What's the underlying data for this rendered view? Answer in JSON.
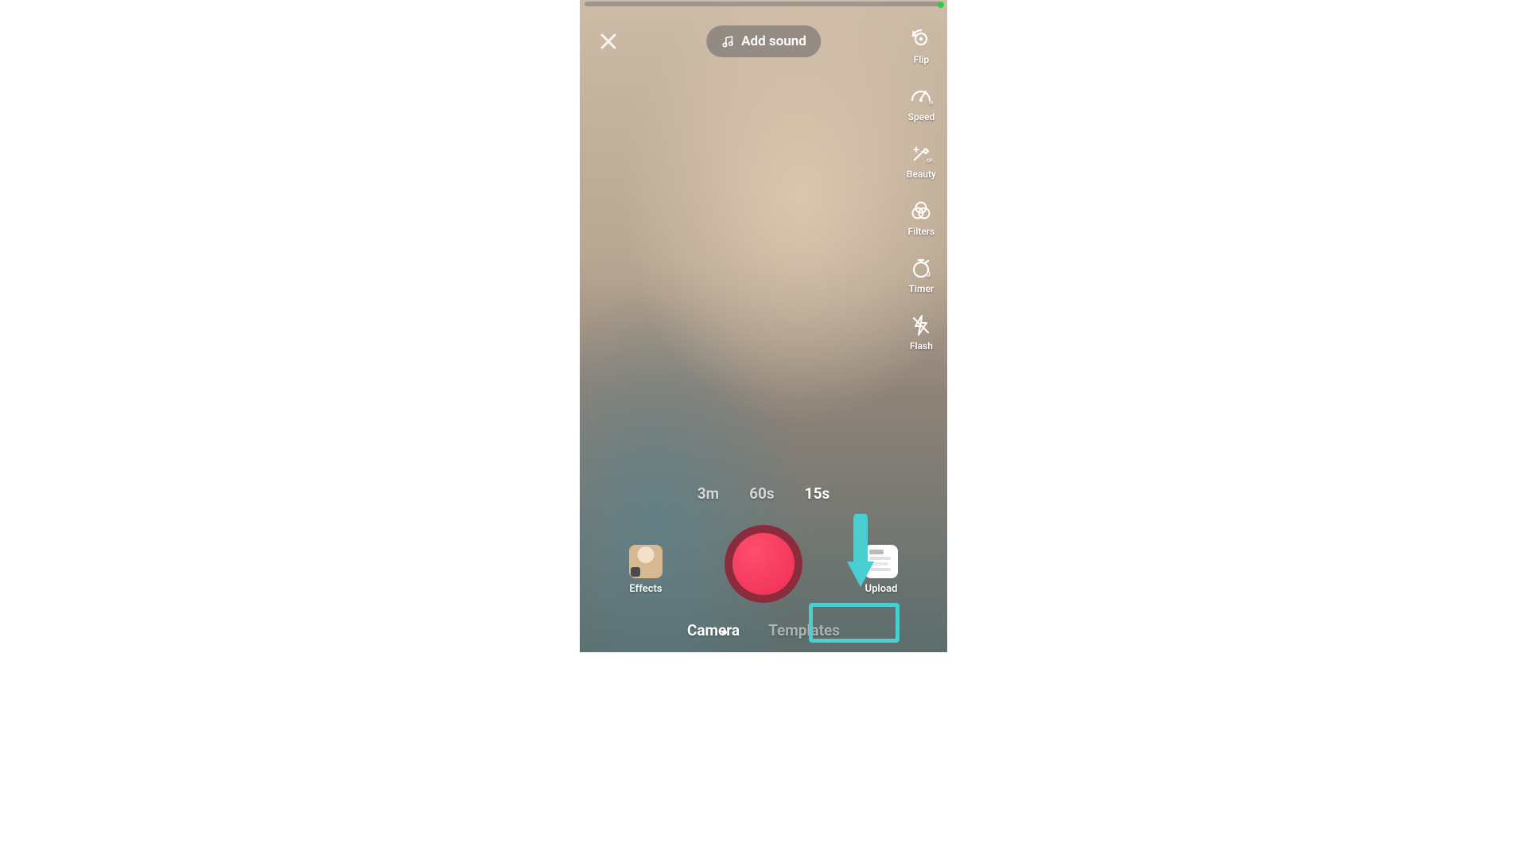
{
  "header": {
    "add_sound_label": "Add sound"
  },
  "right_toolbar": {
    "flip": "Flip",
    "speed": "Speed",
    "beauty": "Beauty",
    "filters": "Filters",
    "timer": "Timer",
    "timer_value": "3",
    "flash": "Flash",
    "off_badge": "OFF"
  },
  "durations": {
    "items": [
      "3m",
      "60s",
      "15s"
    ],
    "selected_index": 2
  },
  "bottom": {
    "effects_label": "Effects",
    "upload_label": "Upload"
  },
  "mode_tabs": {
    "camera": "Camera",
    "templates": "Templates",
    "active": "camera"
  },
  "annotation": {
    "target": "templates"
  }
}
